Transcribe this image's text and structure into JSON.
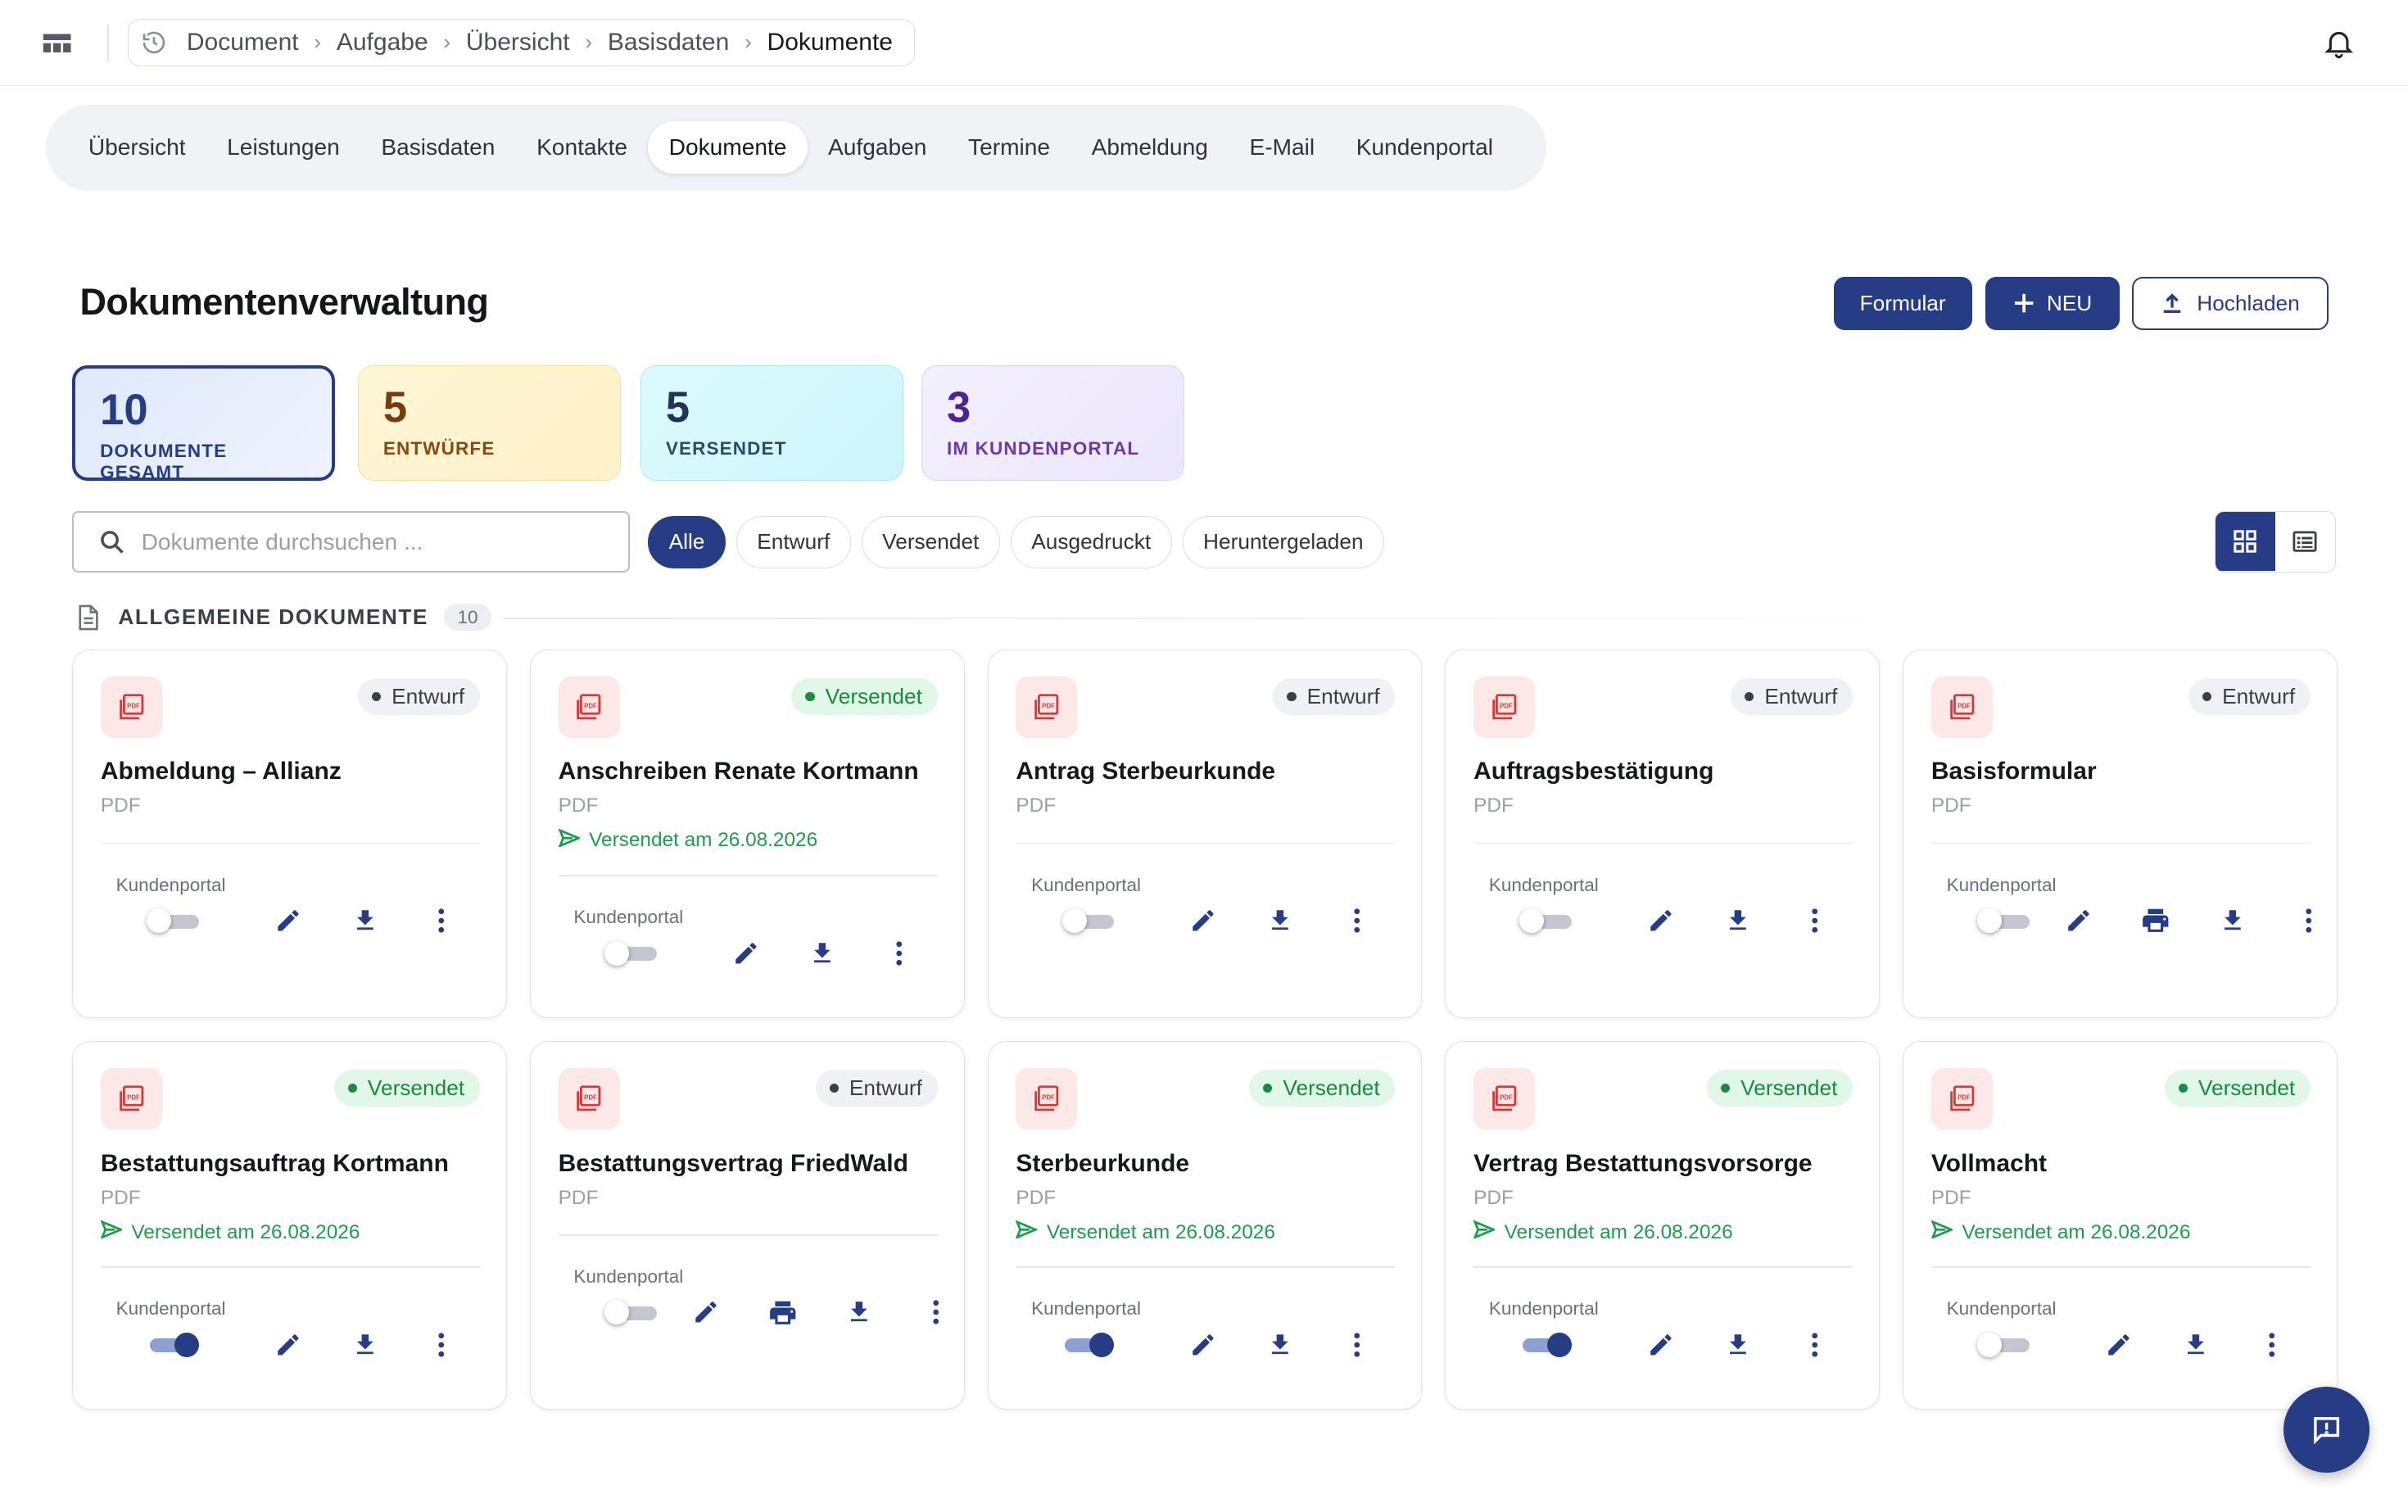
{
  "breadcrumb": [
    "Document",
    "Aufgabe",
    "Übersicht",
    "Basisdaten",
    "Dokumente"
  ],
  "tabs": [
    "Übersicht",
    "Leistungen",
    "Basisdaten",
    "Kontakte",
    "Dokumente",
    "Aufgaben",
    "Termine",
    "Abmeldung",
    "E-Mail",
    "Kundenportal"
  ],
  "active_tab": "Dokumente",
  "page_title": "Dokumentenverwaltung",
  "actions": {
    "formular": "Formular",
    "neu": "NEU",
    "hochladen": "Hochladen"
  },
  "stats": [
    {
      "value": "10",
      "label": "DOKUMENTE GESAMT"
    },
    {
      "value": "5",
      "label": "ENTWÜRFE"
    },
    {
      "value": "5",
      "label": "VERSENDET"
    },
    {
      "value": "3",
      "label": "IM KUNDENPORTAL"
    }
  ],
  "search": {
    "placeholder": "Dokumente durchsuchen ..."
  },
  "filters": [
    "Alle",
    "Entwurf",
    "Versendet",
    "Ausgedruckt",
    "Heruntergeladen"
  ],
  "active_filter": "Alle",
  "section": {
    "title": "ALLGEMEINE DOKUMENTE",
    "count": "10"
  },
  "kundenportal_label": "Kundenportal",
  "documents": [
    {
      "title": "Abmeldung – Allianz",
      "type": "PDF",
      "status": "Entwurf",
      "sent": "",
      "portal": false,
      "print": false
    },
    {
      "title": "Anschreiben Renate Kortmann",
      "type": "PDF",
      "status": "Versendet",
      "sent": "Versendet am 26.08.2026",
      "portal": false,
      "print": false
    },
    {
      "title": "Antrag Sterbeurkunde",
      "type": "PDF",
      "status": "Entwurf",
      "sent": "",
      "portal": false,
      "print": false
    },
    {
      "title": "Auftragsbestätigung",
      "type": "PDF",
      "status": "Entwurf",
      "sent": "",
      "portal": false,
      "print": false
    },
    {
      "title": "Basisformular",
      "type": "PDF",
      "status": "Entwurf",
      "sent": "",
      "portal": false,
      "print": true
    },
    {
      "title": "Bestattungsauftrag Kortmann",
      "type": "PDF",
      "status": "Versendet",
      "sent": "Versendet am 26.08.2026",
      "portal": true,
      "print": false
    },
    {
      "title": "Bestattungsvertrag FriedWald",
      "type": "PDF",
      "status": "Entwurf",
      "sent": "",
      "portal": false,
      "print": true
    },
    {
      "title": "Sterbeurkunde",
      "type": "PDF",
      "status": "Versendet",
      "sent": "Versendet am 26.08.2026",
      "portal": true,
      "print": false
    },
    {
      "title": "Vertrag Bestattungsvorsorge",
      "type": "PDF",
      "status": "Versendet",
      "sent": "Versendet am 26.08.2026",
      "portal": true,
      "print": false
    },
    {
      "title": "Vollmacht",
      "type": "PDF",
      "status": "Versendet",
      "sent": "Versendet am 26.08.2026",
      "portal": false,
      "print": false
    }
  ],
  "colors": {
    "primary": "#263d85",
    "sent_green": "#1f9c4a",
    "pdf_red": "#d93838"
  }
}
